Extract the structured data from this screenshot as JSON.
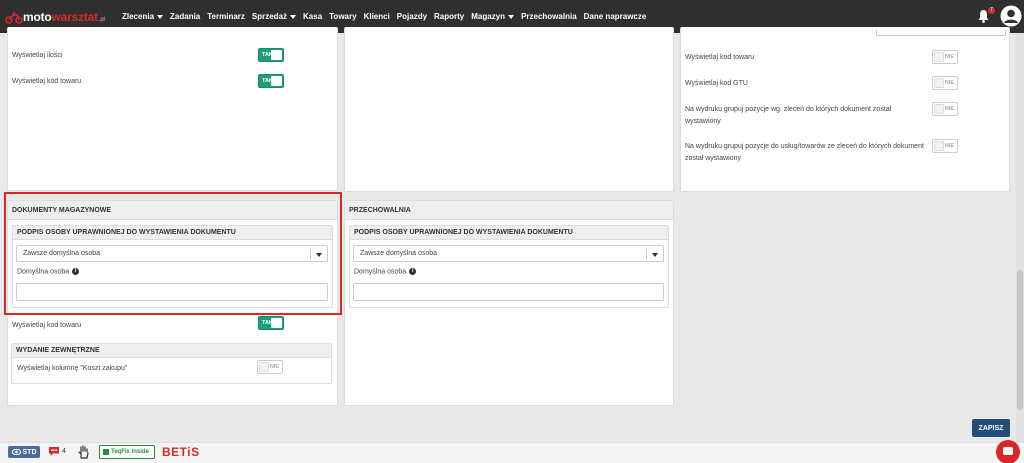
{
  "header": {
    "logo": {
      "part1": "moto",
      "part2": "warsztat",
      "suffix": ".pl"
    },
    "nav": [
      {
        "label": "Zlecenia",
        "dropdown": true
      },
      {
        "label": "Zadania",
        "dropdown": false
      },
      {
        "label": "Terminarz",
        "dropdown": false
      },
      {
        "label": "Sprzedaż",
        "dropdown": true
      },
      {
        "label": "Kasa",
        "dropdown": false
      },
      {
        "label": "Towary",
        "dropdown": false
      },
      {
        "label": "Klienci",
        "dropdown": false
      },
      {
        "label": "Pojazdy",
        "dropdown": false
      },
      {
        "label": "Raporty",
        "dropdown": false
      },
      {
        "label": "Magazyn",
        "dropdown": true
      },
      {
        "label": "Przechowalnia",
        "dropdown": false
      },
      {
        "label": "Dane naprawcze",
        "dropdown": false
      }
    ],
    "notifications_count": "7",
    "icons": {
      "bell": "bell-icon",
      "user": "user-avatar-icon"
    }
  },
  "top_left_panel": {
    "rows": [
      {
        "label": "Wyświetlaj ilości",
        "toggle": "TAK"
      },
      {
        "label": "Wyświetlaj kod towaru",
        "toggle": "TAK"
      }
    ]
  },
  "top_right_panel": {
    "rows": [
      {
        "label": "Wyświetlaj kod towaru",
        "toggle": "NIE"
      },
      {
        "label": "Wyświetlaj kod GTU",
        "toggle": "NIE"
      },
      {
        "label": "Na wydruku grupuj pozycje wg. zleceń do których dokument został wystawiony",
        "toggle": "NIE"
      },
      {
        "label": "Na wydruku grupuj pozycje do usług/towarów ze zleceń do których dokument został wystawiony",
        "toggle": "NIE"
      }
    ]
  },
  "dokumenty_magazynowe": {
    "title": "DOKUMENTY MAGAZYNOWE",
    "signature_section": {
      "title": "PODPIS OSOBY UPRAWNIONEJ DO WYSTAWIENIA DOKUMENTU",
      "select_value": "Zawsze domyślna osoba",
      "default_person_label": "Domyślna osoba",
      "default_person_value": ""
    },
    "show_code": {
      "label": "Wyświetlaj kod towaru",
      "toggle": "TAK"
    },
    "external_issue": {
      "title": "WYDANIE ZEWNĘTRZNE",
      "show_cost": {
        "label": "Wyświetlaj kolumnę \"Koszt zakupu\"",
        "toggle": "NIE"
      }
    }
  },
  "przechowalnia": {
    "title": "PRZECHOWALNIA",
    "signature_section": {
      "title": "PODPIS OSOBY UPRAWNIONEJ DO WYSTAWIENIA DOKUMENTU",
      "select_value": "Zawsze domyślna osoba",
      "default_person_label": "Domyślna osoba",
      "default_person_value": ""
    }
  },
  "save_label": "ZAPISZ",
  "footer": {
    "std_label": "STD",
    "chat_count": "4",
    "teq_label": "TeqFix Inside",
    "betis_label": "BETiS"
  },
  "colors": {
    "accent": "#d62a2a",
    "toggle_on": "#1f9e7a",
    "header_bg": "#2f2f2f",
    "save_btn": "#1f4e79"
  }
}
